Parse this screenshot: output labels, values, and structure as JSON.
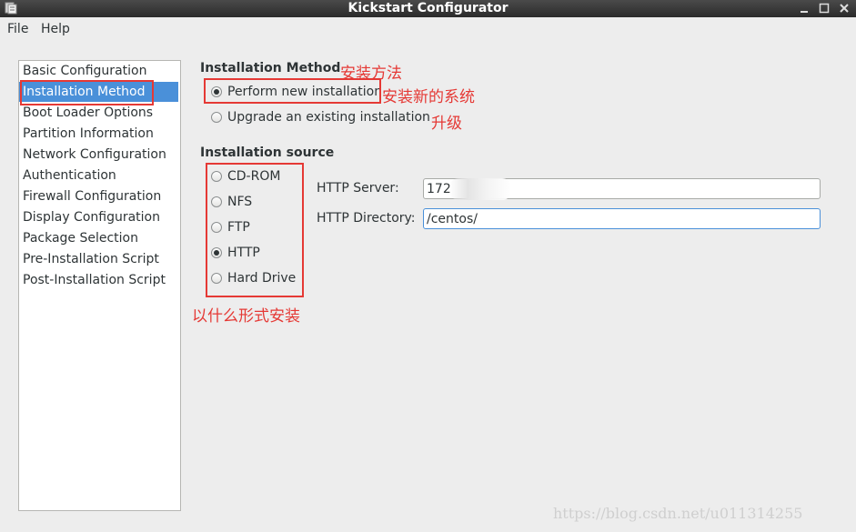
{
  "window": {
    "title": "Kickstart Configurator",
    "icon": "app-icon",
    "buttons": [
      "minimize-icon",
      "maximize-icon",
      "close-icon"
    ]
  },
  "menubar": {
    "items": [
      {
        "label": "File"
      },
      {
        "label": "Help"
      }
    ]
  },
  "sidebar": {
    "selected_index": 1,
    "items": [
      {
        "label": "Basic Configuration"
      },
      {
        "label": "Installation Method"
      },
      {
        "label": "Boot Loader Options"
      },
      {
        "label": "Partition Information"
      },
      {
        "label": "Network Configuration"
      },
      {
        "label": "Authentication"
      },
      {
        "label": "Firewall Configuration"
      },
      {
        "label": "Display Configuration"
      },
      {
        "label": "Package Selection"
      },
      {
        "label": "Pre-Installation Script"
      },
      {
        "label": "Post-Installation Script"
      }
    ]
  },
  "install_method": {
    "title": "Installation Method",
    "options": [
      {
        "label": "Perform new installation",
        "checked": true
      },
      {
        "label": "Upgrade an existing installation",
        "checked": false
      }
    ]
  },
  "install_source": {
    "title": "Installation source",
    "options": [
      {
        "label": "CD-ROM",
        "checked": false
      },
      {
        "label": "NFS",
        "checked": false
      },
      {
        "label": "FTP",
        "checked": false
      },
      {
        "label": "HTTP",
        "checked": true
      },
      {
        "label": "Hard Drive",
        "checked": false
      }
    ],
    "http_server_label": "HTTP Server:",
    "http_server_value": "172",
    "http_directory_label": "HTTP Directory:",
    "http_directory_value": "/centos/"
  },
  "annotations": {
    "install_method": "安装方法",
    "new_install": "安装新的系统",
    "upgrade": "升级",
    "source": "以什么形式安装",
    "color": "#e53935"
  },
  "watermark": "https://blog.csdn.net/u011314255",
  "colors": {
    "selection": "#4a90d9",
    "annotation": "#e53935"
  }
}
